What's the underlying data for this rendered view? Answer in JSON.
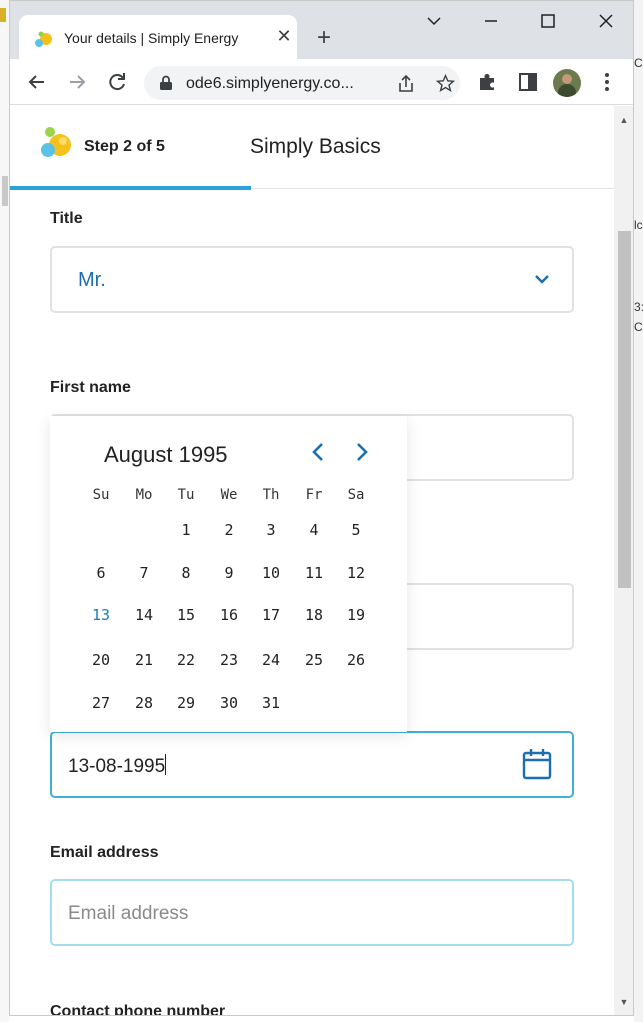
{
  "browser": {
    "tab_title": "Your details | Simply Energy",
    "tab_close_glyph": "✕",
    "new_tab_glyph": "+",
    "url": "ode6.simplyenergy.co...",
    "background_window_text": [
      "lc",
      "3:",
      "C",
      "C"
    ]
  },
  "step": {
    "label": "Step 2 of 5",
    "plan_name": "Simply Basics"
  },
  "form": {
    "title_label": "Title",
    "title_value": "Mr.",
    "first_name_label": "First name",
    "dob_value": "13-08-1995",
    "email_label": "Email address",
    "email_placeholder": "Email address",
    "phone_label": "Contact phone number"
  },
  "datepicker": {
    "month_year": "August 1995",
    "weekdays": [
      "Su",
      "Mo",
      "Tu",
      "We",
      "Th",
      "Fr",
      "Sa"
    ],
    "first_weekday_index": 2,
    "days_in_month": 31,
    "selected_day": 13
  },
  "colors": {
    "accent": "#2ba3d9",
    "link_blue": "#1b6fb0",
    "focus_border": "#3fb0d6"
  },
  "icons": {
    "back": "arrow-left-icon",
    "forward": "arrow-right-icon",
    "reload": "reload-icon",
    "lock": "lock-icon",
    "share": "share-icon",
    "bookmark": "star-icon",
    "extensions": "puzzle-icon",
    "side_panel": "side-panel-icon",
    "profile": "avatar",
    "menu": "kebab-menu-icon",
    "calendar": "calendar-icon"
  }
}
